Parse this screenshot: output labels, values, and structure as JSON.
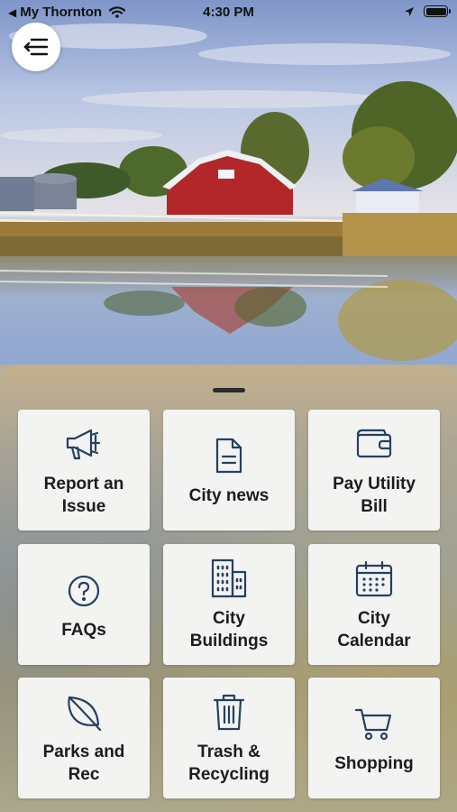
{
  "status_bar": {
    "back_app": "My Thornton",
    "back_glyph": "◀",
    "time": "4:30 PM"
  },
  "menu": {
    "icon": "menu-collapse-icon"
  },
  "tiles": [
    {
      "label": "Report an\nIssue",
      "icon": "megaphone-icon"
    },
    {
      "label": "City news",
      "icon": "document-icon"
    },
    {
      "label": "Pay Utility\nBill",
      "icon": "wallet-icon"
    },
    {
      "label": "FAQs",
      "icon": "question-circle-icon"
    },
    {
      "label": "City\nBuildings",
      "icon": "building-icon"
    },
    {
      "label": "City\nCalendar",
      "icon": "calendar-icon"
    },
    {
      "label": "Parks and\nRec",
      "icon": "leaf-icon"
    },
    {
      "label": "Trash &\nRecycling",
      "icon": "trash-icon"
    },
    {
      "label": "Shopping",
      "icon": "shopping-cart-icon"
    }
  ],
  "colors": {
    "icon_stroke": "#26405f",
    "tile_bg": "#f3f3f2",
    "barn_red": "#b2282a"
  }
}
